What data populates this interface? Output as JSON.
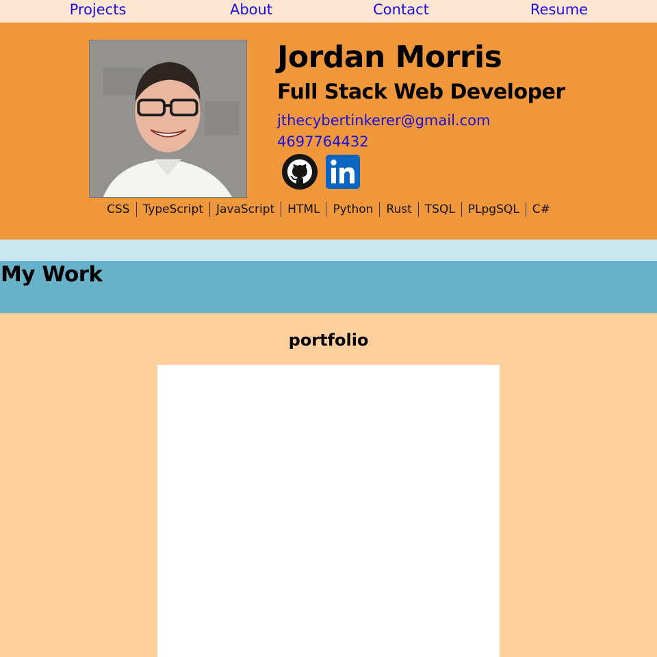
{
  "nav": {
    "items": [
      {
        "label": "Projects"
      },
      {
        "label": "About"
      },
      {
        "label": "Contact"
      },
      {
        "label": "Resume"
      }
    ]
  },
  "header": {
    "name": "Jordan Morris",
    "role": "Full Stack Web Developer",
    "email": "jthecybertinkerer@gmail.com",
    "phone": "4697764432",
    "social": [
      {
        "icon": "github-icon"
      },
      {
        "icon": "linkedin-icon"
      }
    ],
    "skills": [
      "CSS",
      "TypeScript",
      "JavaScript",
      "HTML",
      "Python",
      "Rust",
      "TSQL",
      "PLpgSQL",
      "C#"
    ]
  },
  "section": {
    "title": "My Work"
  },
  "portfolio": {
    "title": "portfolio"
  },
  "colors": {
    "nav_bg": "#fde7d3",
    "link": "#1a0fe0",
    "header_bg": "#ef973a",
    "band_light": "#cbe8f2",
    "band_blue": "#67b1c9",
    "page_bg": "#ffd09e",
    "linkedin": "#0a66c2"
  }
}
